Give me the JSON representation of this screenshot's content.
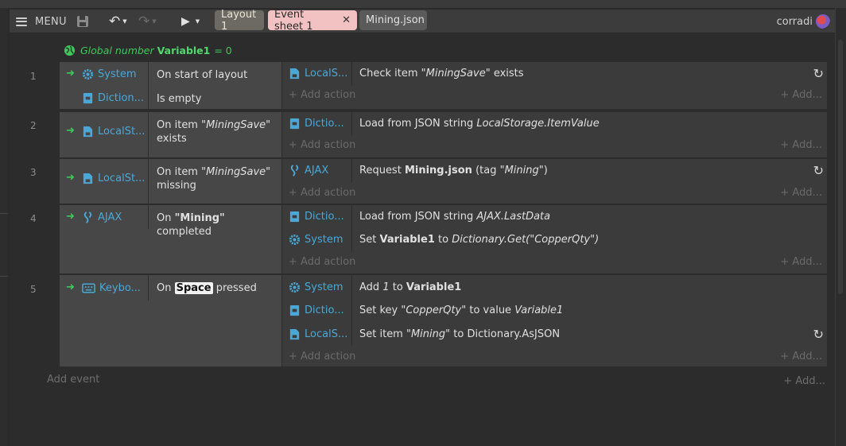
{
  "toolbar": {
    "menu_label": "MENU",
    "tabs": [
      {
        "label": "Layout 1"
      },
      {
        "label": "Event sheet 1"
      },
      {
        "label": "Mining.json"
      }
    ],
    "close_glyph": "✕",
    "user": "corradi"
  },
  "global_var": {
    "prefix": "Global number",
    "name": "Variable1",
    "eq": "= 0"
  },
  "events": [
    {
      "num": "1",
      "conditions": [
        {
          "object": "System",
          "icon": "gear-icon",
          "parts": [
            "On start of layout"
          ]
        },
        {
          "object": "Diction...",
          "icon": "dictionary-icon",
          "parts": [
            "Is empty"
          ]
        }
      ],
      "actions": [
        {
          "object": "LocalS...",
          "icon": "localstorage-icon",
          "text": {
            "a": "Check item ",
            "b": "\"MiningSave\"",
            "c": " exists"
          },
          "await": true
        }
      ],
      "add_action": "Add action",
      "add_right": "Add..."
    },
    {
      "num": "2",
      "conditions": [
        {
          "object": "LocalSt...",
          "icon": "localstorage-icon",
          "line1a": "On item ",
          "line1b": "\"MiningSave\"",
          "line2": "exists"
        }
      ],
      "actions": [
        {
          "object": "Dictio...",
          "icon": "dictionary-icon",
          "text": {
            "a": "Load from JSON string ",
            "b": "LocalStorage.ItemValue",
            "c": ""
          }
        }
      ],
      "add_action": "Add action",
      "add_right": "Add..."
    },
    {
      "num": "3",
      "conditions": [
        {
          "object": "LocalSt...",
          "icon": "localstorage-icon",
          "line1a": "On item ",
          "line1b": "\"MiningSave\"",
          "line2": "missing"
        }
      ],
      "actions": [
        {
          "object": "AJAX",
          "icon": "ajax-icon",
          "text": {
            "a": "Request ",
            "b": "Mining.json",
            "c": " (tag ",
            "d": "\"Mining\"",
            "e": ")"
          },
          "await": true
        }
      ],
      "add_action": "Add action",
      "add_right": "Add..."
    },
    {
      "num": "4",
      "conditions": [
        {
          "object": "AJAX",
          "icon": "ajax-icon",
          "a": "On ",
          "b": "\"Mining\"",
          "c": " completed"
        }
      ],
      "actions": [
        {
          "object": "Dictio...",
          "icon": "dictionary-icon",
          "text": {
            "a": "Load from JSON string ",
            "b": "AJAX.LastData"
          }
        },
        {
          "object": "System",
          "icon": "gear-icon",
          "text": {
            "a": "Set ",
            "b": "Variable1",
            "c": " to ",
            "d": "Dictionary.Get(\"CopperQty\")"
          }
        }
      ],
      "add_action": "Add action",
      "add_right": "Add..."
    },
    {
      "num": "5",
      "conditions": [
        {
          "object": "Keybo...",
          "icon": "keyboard-icon",
          "a": "On ",
          "b": "Space",
          "c": " pressed"
        }
      ],
      "actions": [
        {
          "object": "System",
          "icon": "gear-icon",
          "text": {
            "a": "Add ",
            "b": "1",
            "c": " to ",
            "d": "Variable1"
          }
        },
        {
          "object": "Dictio...",
          "icon": "dictionary-icon",
          "text": {
            "a": "Set key ",
            "b": "\"CopperQty\"",
            "c": " to value ",
            "d": "Variable1"
          }
        },
        {
          "object": "LocalS...",
          "icon": "localstorage-icon",
          "text": {
            "a": "Set item ",
            "b": "\"Mining\"",
            "c": " to Dictionary.AsJSON"
          },
          "await": true
        }
      ],
      "add_action": "Add action",
      "add_right": "Add..."
    }
  ],
  "add_event": "Add event",
  "add_event_right": "Add...",
  "colors": {
    "accent_green": "#3ec95c",
    "object_blue": "#4aa8d8",
    "tab_active": "#f2c2c2",
    "tab_layout": "#6c6a62"
  }
}
